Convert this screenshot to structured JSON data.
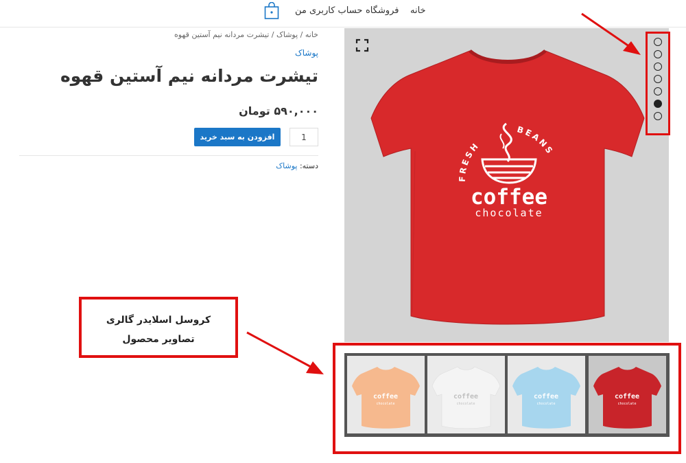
{
  "nav": {
    "home": "خانه",
    "shop": "فروشگاه",
    "account": "حساب کاربری من",
    "cart_icon": "shopping-bag-icon"
  },
  "breadcrumb": {
    "home": "خانه",
    "sep1": " / ",
    "category": "پوشاک",
    "sep2": " / ",
    "current": "تیشرت مردانه نیم آستین قهوه"
  },
  "product": {
    "category_top": "پوشاک",
    "title": "تیشرت مردانه نیم آستین قهوه",
    "price": "۵۹۰,۰۰۰ تومان",
    "quantity": "1",
    "add_to_cart": "افزودن به سبد خرید",
    "category_label": "دسته:",
    "category_link": "پوشاک"
  },
  "gallery": {
    "zoom_icon": "fullscreen-icon",
    "shirt_print": {
      "arc_left": "FRESH",
      "arc_right": "BEANS",
      "word1": "coffee",
      "word2": "chocolate"
    },
    "main_color": "#d8292b",
    "slide_count": 7,
    "active_slide": 6,
    "thumbnails": [
      {
        "color": "#f6b98e",
        "bg": "#e9e9e9",
        "ink": "#ffffff"
      },
      {
        "color": "#f4f4f4",
        "bg": "#ebebeb",
        "ink": "#bfbfbf"
      },
      {
        "color": "#a7d6ee",
        "bg": "#e9e9e9",
        "ink": "#ffffff"
      },
      {
        "color": "#c8242a",
        "bg": "#c8c8c8",
        "ink": "#ffffff"
      }
    ]
  },
  "annotation": {
    "callout_text": "کروسل اسلایدر گالری تصاویر محصول",
    "highlight_color": "#e01010"
  }
}
